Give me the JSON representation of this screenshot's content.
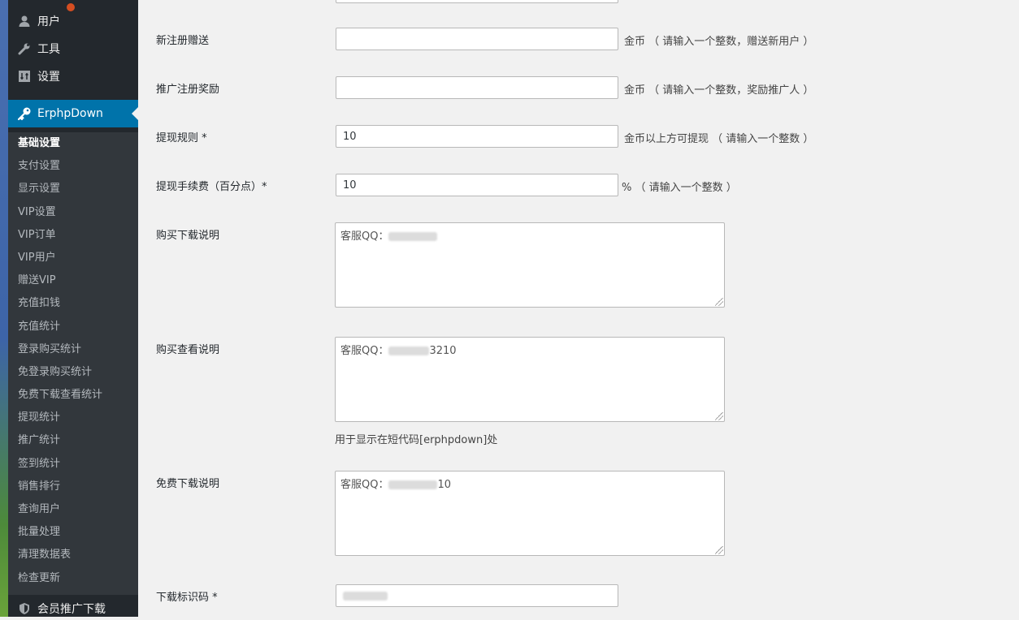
{
  "sidebar": {
    "top_items": [
      {
        "label": "用户",
        "icon": "user-icon"
      },
      {
        "label": "工具",
        "icon": "wrench-icon"
      },
      {
        "label": "设置",
        "icon": "settings-icon"
      }
    ],
    "active_item": {
      "label": "ErphpDown",
      "icon": "key-icon"
    },
    "submenu": [
      "基础设置",
      "支付设置",
      "显示设置",
      "VIP设置",
      "VIP订单",
      "VIP用户",
      "赠送VIP",
      "充值扣钱",
      "充值统计",
      "登录购买统计",
      "免登录购买统计",
      "免费下载查看统计",
      "提现统计",
      "推广统计",
      "签到统计",
      "销售排行",
      "查询用户",
      "批量处理",
      "清理数据表",
      "检查更新"
    ],
    "bottom_item": {
      "label": "会员推广下载",
      "icon": "shield-icon"
    },
    "colors": {
      "bg": "#23282d",
      "submenu_bg": "#32373c",
      "active": "#0073aa"
    }
  },
  "form": {
    "rows": [
      {
        "label": "新注册赠送",
        "value": "",
        "hint": "金币 （ 请输入一个整数，赠送新用户 ）"
      },
      {
        "label": "推广注册奖励",
        "value": "",
        "hint": "金币 （ 请输入一个整数，奖励推广人 ）"
      },
      {
        "label": "提现规则 *",
        "value": "10",
        "hint": "金币以上方可提现 （ 请输入一个整数 ）"
      },
      {
        "label": "提现手续费（百分点）*",
        "value": "10",
        "hint": "% （ 请输入一个整数 ）"
      }
    ],
    "textareas": [
      {
        "label": "购买下载说明",
        "prefix": "客服QQ：",
        "suffix": "",
        "note": ""
      },
      {
        "label": "购买查看说明",
        "prefix": "客服QQ：",
        "suffix": "3210",
        "note": "用于显示在短代码[erphpdown]处"
      },
      {
        "label": "免费下载说明",
        "prefix": "客服QQ：",
        "suffix": "10",
        "note": ""
      }
    ],
    "code_row": {
      "label": "下载标识码 *",
      "value": ""
    }
  }
}
